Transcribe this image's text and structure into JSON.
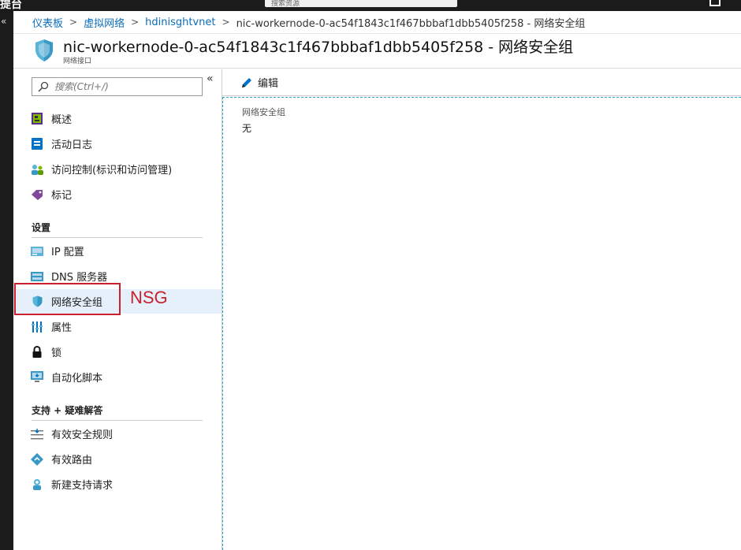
{
  "topbar": {
    "logo_fragment": "提台",
    "search_fragment": "搜索资源"
  },
  "breadcrumb": {
    "items": [
      "仪表板",
      "虚拟网络",
      "hdinisghtvnet"
    ],
    "current": "nic-workernode-0-ac54f1843c1f467bbbaf1dbb5405f258 - 网络安全组"
  },
  "header": {
    "title": "nic-workernode-0-ac54f1843c1f467bbbaf1dbb5405f258 - 网络安全组",
    "subtitle": "网络接口"
  },
  "sidebar": {
    "search_placeholder": "搜索(Ctrl+/)",
    "collapse_label": "«",
    "items_top": [
      {
        "label": "概述",
        "icon": "overview-icon"
      },
      {
        "label": "活动日志",
        "icon": "activity-log-icon"
      },
      {
        "label": "访问控制(标识和访问管理)",
        "icon": "access-control-icon"
      },
      {
        "label": "标记",
        "icon": "tag-icon"
      }
    ],
    "section_settings": "设置",
    "items_settings": [
      {
        "label": "IP 配置",
        "icon": "ip-config-icon"
      },
      {
        "label": "DNS 服务器",
        "icon": "dns-icon"
      },
      {
        "label": "网络安全组",
        "icon": "shield-icon",
        "selected": true
      },
      {
        "label": "属性",
        "icon": "properties-icon"
      },
      {
        "label": "锁",
        "icon": "lock-icon"
      },
      {
        "label": "自动化脚本",
        "icon": "automation-script-icon"
      }
    ],
    "section_support": "支持 + 疑难解答",
    "items_support": [
      {
        "label": "有效安全规则",
        "icon": "security-rules-icon"
      },
      {
        "label": "有效路由",
        "icon": "routes-icon"
      },
      {
        "label": "新建支持请求",
        "icon": "support-icon"
      }
    ]
  },
  "annotation": {
    "text": "NSG",
    "color": "#c8202c"
  },
  "toolbar": {
    "edit_label": "编辑"
  },
  "content": {
    "field_label": "网络安全组",
    "field_value": "无"
  },
  "colors": {
    "link": "#0a6ebd",
    "selected_bg": "#e5f0fb",
    "accent": "#0078d4"
  }
}
